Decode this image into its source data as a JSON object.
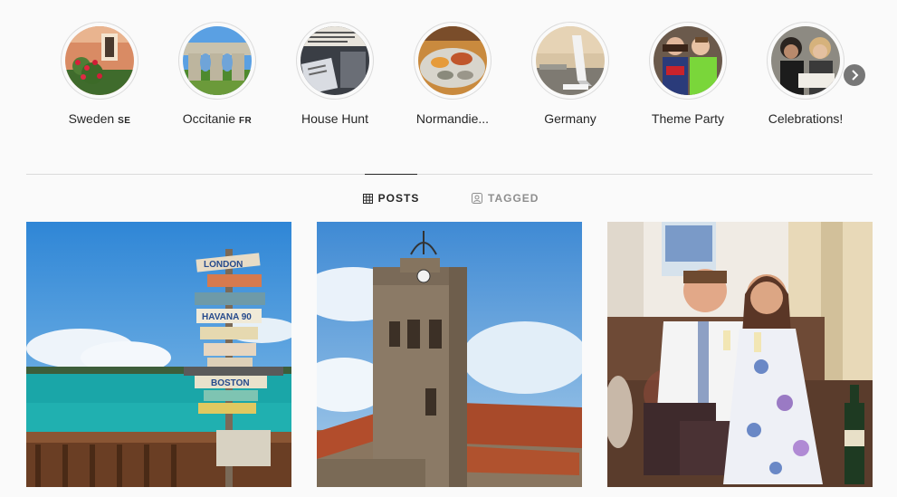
{
  "highlights": [
    {
      "label": "Sweden",
      "flag": "SE",
      "icon": "sweden-house-roses"
    },
    {
      "label": "Occitanie",
      "flag": "FR",
      "icon": "aqueduct-arches"
    },
    {
      "label": "House Hunt",
      "flag": "",
      "icon": "newspaper-documents"
    },
    {
      "label": "Normandie...",
      "flag": "",
      "icon": "seafood-platter"
    },
    {
      "label": "Germany",
      "flag": "",
      "icon": "airplane-wing"
    },
    {
      "label": "Theme Party",
      "flag": "",
      "icon": "costume-party"
    },
    {
      "label": "Celebrations!",
      "flag": "",
      "icon": "friends-celebrating"
    }
  ],
  "tabs": [
    {
      "label": "POSTS",
      "icon": "grid-icon",
      "active": true
    },
    {
      "label": "TAGGED",
      "icon": "tag-icon",
      "active": false
    }
  ],
  "posts": [
    {
      "icon": "signpost-sea-photo",
      "signs": [
        "LONDON",
        "HAVANA 90",
        "BOSTON"
      ]
    },
    {
      "icon": "church-tower-photo"
    },
    {
      "icon": "couple-champagne-photo"
    }
  ],
  "colors": {
    "background": "#fafafa",
    "text": "#262626",
    "muted": "#8e8e8e",
    "border": "#dbdbdb"
  }
}
